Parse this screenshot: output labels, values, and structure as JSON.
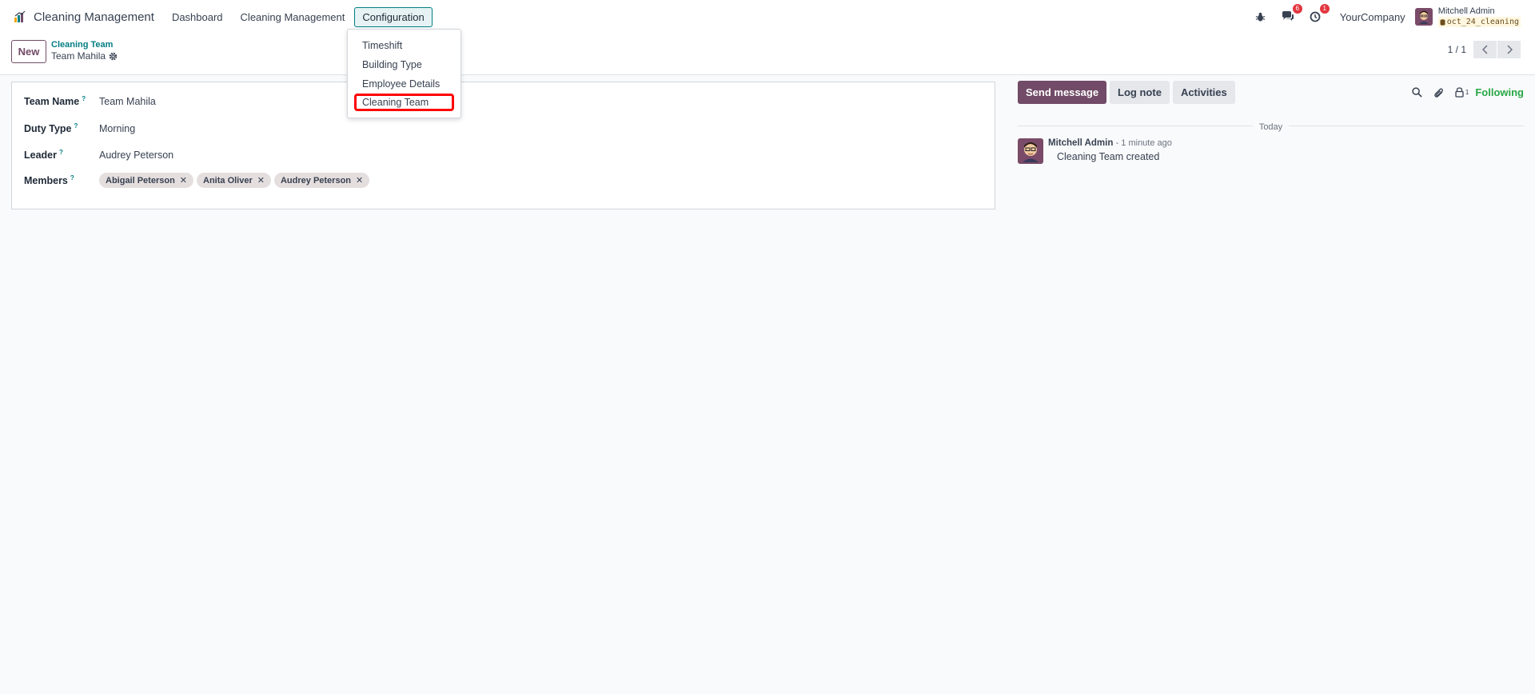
{
  "navbar": {
    "brand": "Cleaning Management",
    "menu": [
      "Dashboard",
      "Cleaning Management",
      "Configuration"
    ],
    "active_menu_index": 2,
    "messages_badge": "6",
    "activities_badge": "1",
    "company": "YourCompany",
    "user_name": "Mitchell Admin",
    "database": "oct_24_cleaning"
  },
  "control_panel": {
    "new_label": "New",
    "breadcrumb_parent": "Cleaning Team",
    "breadcrumb_current": "Team Mahila",
    "pager_value": "1 / 1"
  },
  "dropdown": {
    "items": [
      "Timeshift",
      "Building Type",
      "Employee Details",
      "Cleaning Team"
    ],
    "highlighted_index": 3
  },
  "form": {
    "team_name_label": "Team Name",
    "team_name_value": "Team Mahila",
    "duty_type_label": "Duty Type",
    "duty_type_value": "Morning",
    "leader_label": "Leader",
    "leader_value": "Audrey Peterson",
    "members_label": "Members",
    "members": [
      "Abigail Peterson",
      "Anita Oliver",
      "Audrey Peterson"
    ],
    "help_marker": "?"
  },
  "chatter": {
    "send_message": "Send message",
    "log_note": "Log note",
    "activities": "Activities",
    "followers_count": "1",
    "following": "Following",
    "date_separator": "Today",
    "message_author": "Mitchell Admin",
    "message_time": "- 1 minute ago",
    "message_text": "Cleaning Team created"
  },
  "colors": {
    "brand_purple": "#714b67",
    "teal": "#017e84",
    "following_green": "#28a745",
    "badge_red": "#e2363f",
    "highlight_red": "#ff0000"
  }
}
